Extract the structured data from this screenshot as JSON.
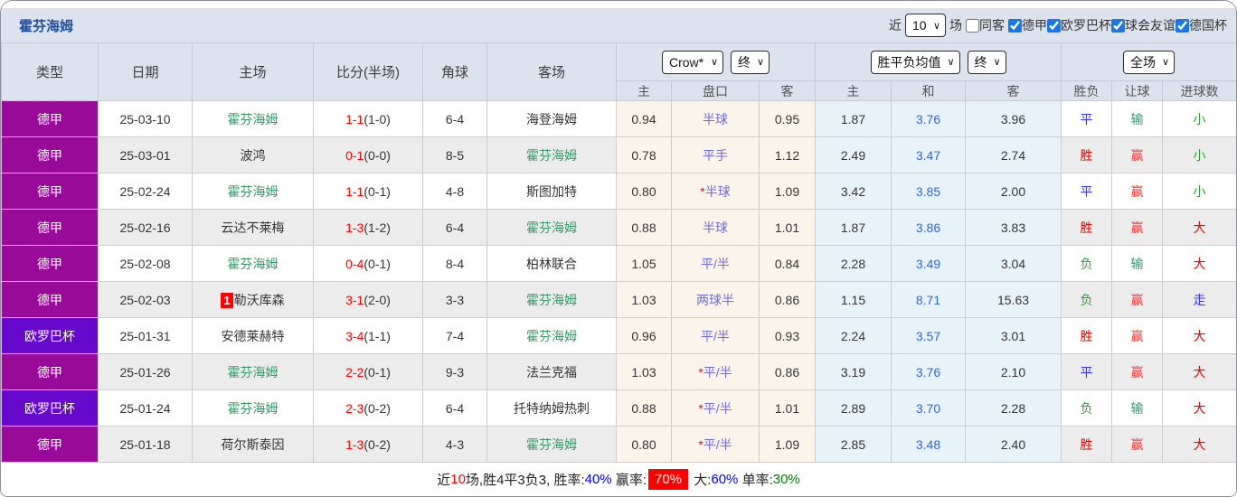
{
  "header": {
    "team_title": "霍芬海姆",
    "filters": {
      "recent_label": "近",
      "recent_value": "10",
      "recent_suffix": "场",
      "same_away_label": "同客",
      "same_away_checked": false,
      "leagues": [
        {
          "label": "德甲",
          "checked": true
        },
        {
          "label": "欧罗巴杯",
          "checked": true
        },
        {
          "label": "球会友谊",
          "checked": true
        },
        {
          "label": "德国杯",
          "checked": true
        }
      ]
    }
  },
  "table": {
    "columns": {
      "type": "类型",
      "date": "日期",
      "home": "主场",
      "score": "比分(半场)",
      "corner": "角球",
      "away": "客场"
    },
    "selects": {
      "odds_company": "Crow*",
      "odds_stage1": "终",
      "avg_type": "胜平负均值",
      "odds_stage2": "终",
      "scope": "全场"
    },
    "subheaders": [
      "主",
      "盘口",
      "客",
      "主",
      "和",
      "客",
      "胜负",
      "让球",
      "进球数"
    ],
    "rows": [
      {
        "league": "德甲",
        "league_type": "bundesliga",
        "date": "25-03-10",
        "home": "霍芬海姆",
        "home_main": true,
        "home_badge": "",
        "score": "1-1",
        "half": "(1-0)",
        "corners": "6-4",
        "away": "海登海姆",
        "away_main": false,
        "crow_home": "0.94",
        "handicap": "半球",
        "handicap_star": false,
        "crow_away": "0.95",
        "avg_home": "1.87",
        "avg_draw": "3.76",
        "avg_away": "3.96",
        "res_wdl": "平",
        "res_handicap": "输",
        "res_goals": "小"
      },
      {
        "league": "德甲",
        "league_type": "bundesliga",
        "date": "25-03-01",
        "home": "波鸿",
        "home_main": false,
        "home_badge": "",
        "score": "0-1",
        "half": "(0-0)",
        "corners": "8-5",
        "away": "霍芬海姆",
        "away_main": true,
        "crow_home": "0.78",
        "handicap": "平手",
        "handicap_star": false,
        "crow_away": "1.12",
        "avg_home": "2.49",
        "avg_draw": "3.47",
        "avg_away": "2.74",
        "res_wdl": "胜",
        "res_handicap": "赢",
        "res_goals": "小"
      },
      {
        "league": "德甲",
        "league_type": "bundesliga",
        "date": "25-02-24",
        "home": "霍芬海姆",
        "home_main": true,
        "home_badge": "",
        "score": "1-1",
        "half": "(0-1)",
        "corners": "4-8",
        "away": "斯图加特",
        "away_main": false,
        "crow_home": "0.80",
        "handicap": "半球",
        "handicap_star": true,
        "crow_away": "1.09",
        "avg_home": "3.42",
        "avg_draw": "3.85",
        "avg_away": "2.00",
        "res_wdl": "平",
        "res_handicap": "赢",
        "res_goals": "小"
      },
      {
        "league": "德甲",
        "league_type": "bundesliga",
        "date": "25-02-16",
        "home": "云达不莱梅",
        "home_main": false,
        "home_badge": "",
        "score": "1-3",
        "half": "(1-2)",
        "corners": "6-4",
        "away": "霍芬海姆",
        "away_main": true,
        "crow_home": "0.88",
        "handicap": "半球",
        "handicap_star": false,
        "crow_away": "1.01",
        "avg_home": "1.87",
        "avg_draw": "3.86",
        "avg_away": "3.83",
        "res_wdl": "胜",
        "res_handicap": "赢",
        "res_goals": "大"
      },
      {
        "league": "德甲",
        "league_type": "bundesliga",
        "date": "25-02-08",
        "home": "霍芬海姆",
        "home_main": true,
        "home_badge": "",
        "score": "0-4",
        "half": "(0-1)",
        "corners": "8-4",
        "away": "柏林联合",
        "away_main": false,
        "crow_home": "1.05",
        "handicap": "平/半",
        "handicap_star": false,
        "crow_away": "0.84",
        "avg_home": "2.28",
        "avg_draw": "3.49",
        "avg_away": "3.04",
        "res_wdl": "负",
        "res_handicap": "输",
        "res_goals": "大"
      },
      {
        "league": "德甲",
        "league_type": "bundesliga",
        "date": "25-02-03",
        "home": "勒沃库森",
        "home_main": false,
        "home_badge": "1",
        "score": "3-1",
        "half": "(2-0)",
        "corners": "3-3",
        "away": "霍芬海姆",
        "away_main": true,
        "crow_home": "1.03",
        "handicap": "两球半",
        "handicap_star": false,
        "crow_away": "0.86",
        "avg_home": "1.15",
        "avg_draw": "8.71",
        "avg_away": "15.63",
        "res_wdl": "负",
        "res_handicap": "赢",
        "res_goals": "走"
      },
      {
        "league": "欧罗巴杯",
        "league_type": "europa",
        "date": "25-01-31",
        "home": "安德莱赫特",
        "home_main": false,
        "home_badge": "",
        "score": "3-4",
        "half": "(1-1)",
        "corners": "7-4",
        "away": "霍芬海姆",
        "away_main": true,
        "crow_home": "0.96",
        "handicap": "平/半",
        "handicap_star": false,
        "crow_away": "0.93",
        "avg_home": "2.24",
        "avg_draw": "3.57",
        "avg_away": "3.01",
        "res_wdl": "胜",
        "res_handicap": "赢",
        "res_goals": "大"
      },
      {
        "league": "德甲",
        "league_type": "bundesliga",
        "date": "25-01-26",
        "home": "霍芬海姆",
        "home_main": true,
        "home_badge": "",
        "score": "2-2",
        "half": "(0-1)",
        "corners": "9-3",
        "away": "法兰克福",
        "away_main": false,
        "crow_home": "1.03",
        "handicap": "平/半",
        "handicap_star": true,
        "crow_away": "0.86",
        "avg_home": "3.19",
        "avg_draw": "3.76",
        "avg_away": "2.10",
        "res_wdl": "平",
        "res_handicap": "赢",
        "res_goals": "大"
      },
      {
        "league": "欧罗巴杯",
        "league_type": "europa",
        "date": "25-01-24",
        "home": "霍芬海姆",
        "home_main": true,
        "home_badge": "",
        "score": "2-3",
        "half": "(0-2)",
        "corners": "6-4",
        "away": "托特纳姆热刺",
        "away_main": false,
        "crow_home": "0.88",
        "handicap": "平/半",
        "handicap_star": true,
        "crow_away": "1.01",
        "avg_home": "2.89",
        "avg_draw": "3.70",
        "avg_away": "2.28",
        "res_wdl": "负",
        "res_handicap": "输",
        "res_goals": "大"
      },
      {
        "league": "德甲",
        "league_type": "bundesliga",
        "date": "25-01-18",
        "home": "荷尔斯泰因",
        "home_main": false,
        "home_badge": "",
        "score": "1-3",
        "half": "(0-2)",
        "corners": "4-3",
        "away": "霍芬海姆",
        "away_main": true,
        "crow_home": "0.80",
        "handicap": "平/半",
        "handicap_star": true,
        "crow_away": "1.09",
        "avg_home": "2.85",
        "avg_draw": "3.48",
        "avg_away": "2.40",
        "res_wdl": "胜",
        "res_handicap": "赢",
        "res_goals": "大"
      }
    ]
  },
  "footer": {
    "segments": [
      {
        "text": "近",
        "style": "plain"
      },
      {
        "text": "10",
        "style": "red"
      },
      {
        "text": "场,胜4平3负3, 胜率:",
        "style": "plain"
      },
      {
        "text": "40%",
        "style": "blue"
      },
      {
        "text": " 赢率:",
        "style": "plain"
      },
      {
        "text": "70%",
        "style": "highlight"
      },
      {
        "text": " 大:",
        "style": "plain"
      },
      {
        "text": "60%",
        "style": "blue"
      },
      {
        "text": " 单率:",
        "style": "plain"
      },
      {
        "text": "30%",
        "style": "green"
      }
    ]
  },
  "colors": {
    "league": {
      "bundesliga": "#990a99",
      "europa": "#6609cc"
    },
    "result_map": {
      "胜": "#e60000",
      "平": "#3333ff",
      "负": "#339933",
      "赢": "#ff3333",
      "输": "#36996e",
      "走": "#3333ff",
      "大": "#e60000",
      "小": "#339933"
    },
    "accent_title": "#1d4e9e",
    "checkbox_blue": "#1778e9",
    "avg_draw_blue": "#3366cc",
    "handicap_purple": "#6e6ad8",
    "score_red": "#ff0000"
  }
}
